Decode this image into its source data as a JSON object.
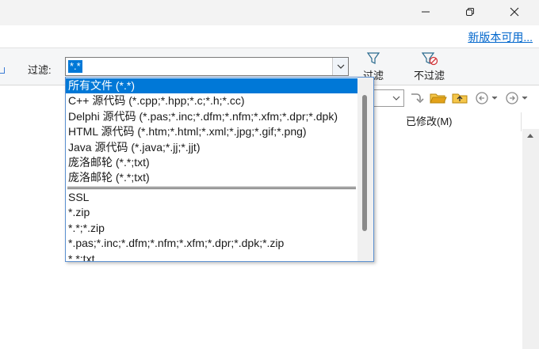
{
  "titlebar": {
    "icons": [
      "minimize-icon",
      "restore-icon",
      "close-icon"
    ]
  },
  "update": {
    "link": "新版本可用..."
  },
  "toolbar": {
    "filter_label": "过滤:",
    "filter_value": "*.*",
    "filter_button": "过滤",
    "no_filter_button": "不过滤",
    "icons": [
      "funnel-icon",
      "funnel-cancel-icon"
    ]
  },
  "columns": {
    "modified": "已修改(M)"
  },
  "dropdown": {
    "items": [
      "所有文件 (*.*)",
      "C++ 源代码 (*.cpp;*.hpp;*.c;*.h;*.cc)",
      "Delphi 源代码 (*.pas;*.inc;*.dfm;*.nfm;*.xfm;*.dpr;*.dpk)",
      "HTML 源代码 (*.htm;*.html;*.xml;*.jpg;*.gif;*.png)",
      "Java 源代码 (*.java;*.jj;*.jjt)",
      "庞洛邮轮 (*.*;txt)",
      "庞洛邮轮 (*.*;txt)"
    ],
    "history": [
      "SSL",
      "*.zip",
      "*.*;*.zip",
      "*.pas;*.inc;*.dfm;*.nfm;*.xfm;*.dpr;*.dpk;*.zip",
      "*.*;txt"
    ],
    "selected_index": 0
  },
  "colors": {
    "accent": "#0078d7",
    "link": "#0066cc",
    "folder": "#e3a21a"
  }
}
